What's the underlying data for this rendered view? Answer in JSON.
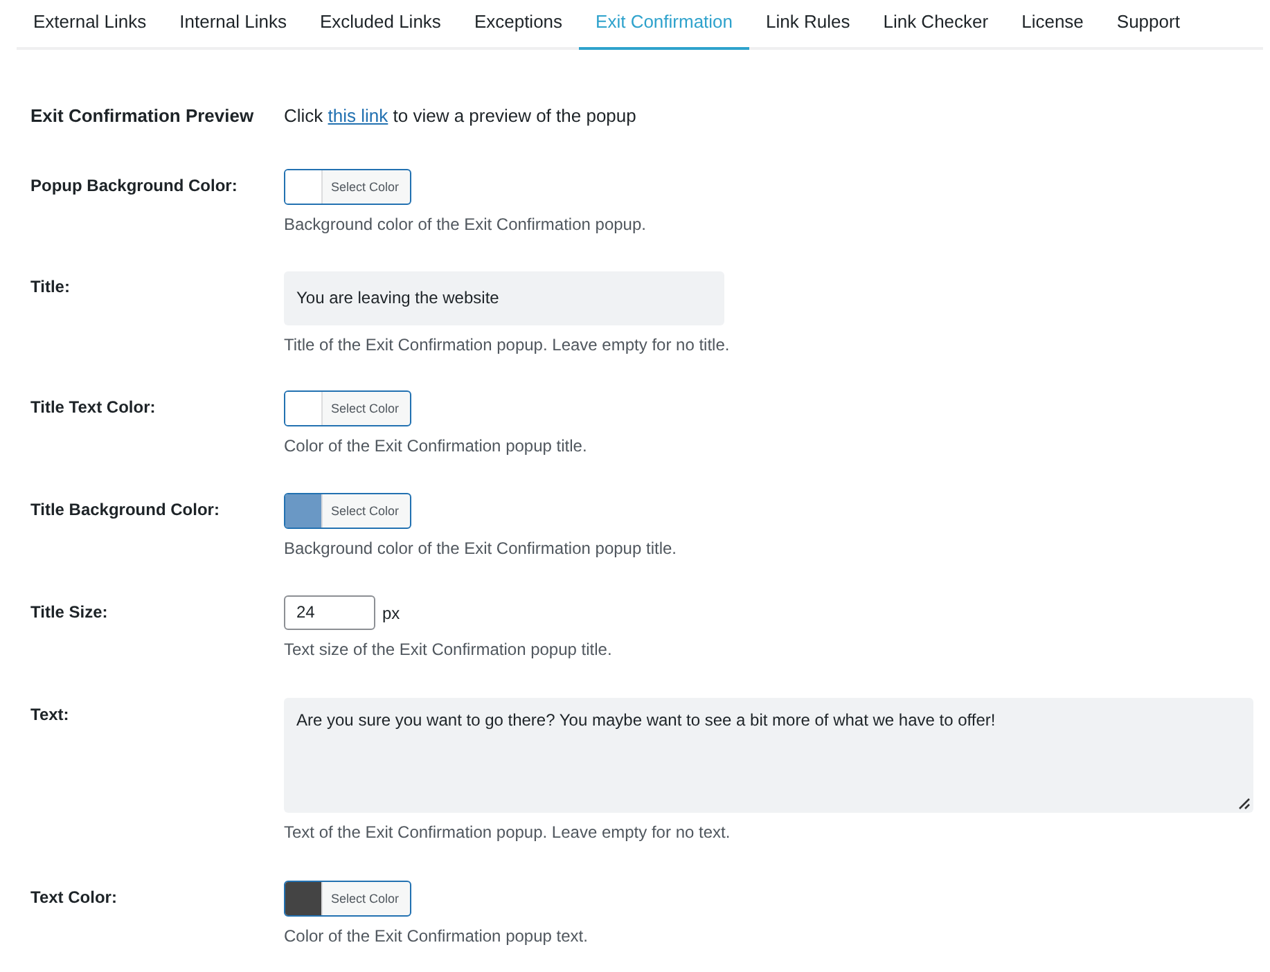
{
  "tabs": [
    {
      "label": "External Links",
      "selected": false
    },
    {
      "label": "Internal Links",
      "selected": false
    },
    {
      "label": "Excluded Links",
      "selected": false
    },
    {
      "label": "Exceptions",
      "selected": false
    },
    {
      "label": "Exit Confirmation",
      "selected": true
    },
    {
      "label": "Link Rules",
      "selected": false
    },
    {
      "label": "Link Checker",
      "selected": false
    },
    {
      "label": "License",
      "selected": false
    },
    {
      "label": "Support",
      "selected": false
    }
  ],
  "settings": [
    {
      "kind": "preview",
      "label": "Exit Confirmation Preview",
      "before": "Click",
      "link": "this link",
      "after": "to view a preview of the popup"
    },
    {
      "kind": "color",
      "label": "Popup Background Color:",
      "button": "Select Color",
      "color": "#ffffff",
      "help": "Background color of the Exit Confirmation popup."
    },
    {
      "kind": "text",
      "label": "Title:",
      "value": "You are leaving the website",
      "help": "Title of the Exit Confirmation popup. Leave empty for no title."
    },
    {
      "kind": "color",
      "label": "Title Text Color:",
      "button": "Select Color",
      "color": "#ffffff",
      "help": "Color of the Exit Confirmation popup title."
    },
    {
      "kind": "color",
      "label": "Title Background Color:",
      "button": "Select Color",
      "color": "#6a98c5",
      "help": "Background color of the Exit Confirmation popup title."
    },
    {
      "kind": "number",
      "label": "Title Size:",
      "value": "24",
      "unit": "px",
      "help": "Text size of the Exit Confirmation popup title."
    },
    {
      "kind": "textarea",
      "label": "Text:",
      "value": "Are you sure you want to go there? You maybe want to see a bit more of what we have to offer!",
      "help": "Text of the Exit Confirmation popup. Leave empty for no text."
    },
    {
      "kind": "color",
      "label": "Text Color:",
      "button": "Select Color",
      "color": "#444444",
      "help": "Color of the Exit Confirmation popup text."
    }
  ]
}
